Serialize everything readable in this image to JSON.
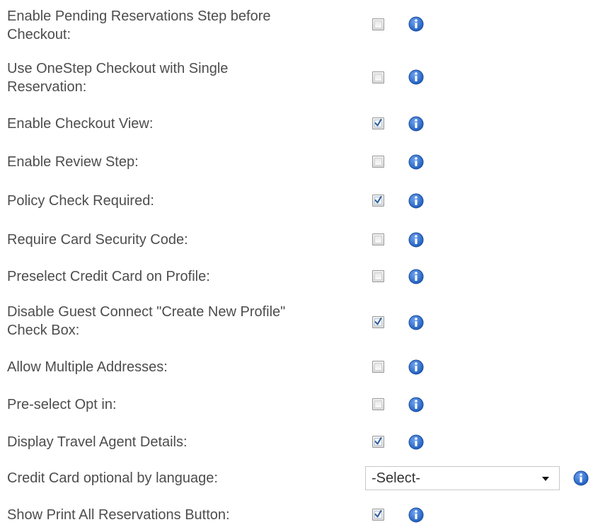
{
  "settings": {
    "rows": [
      {
        "label": "Enable Pending Reservations Step before\nCheckout:",
        "checked": false
      },
      {
        "label": "Use OneStep Checkout with Single\nReservation:",
        "checked": false
      },
      {
        "label": "Enable Checkout View:",
        "checked": true
      },
      {
        "label": "Enable Review Step:",
        "checked": false
      },
      {
        "label": "Policy Check Required:",
        "checked": true
      },
      {
        "label": "Require Card Security Code:",
        "checked": false
      },
      {
        "label": "Preselect Credit Card on Profile:",
        "checked": false
      },
      {
        "label": "Disable Guest Connect \"Create New Profile\"\nCheck Box:",
        "checked": true
      },
      {
        "label": "Allow Multiple Addresses:",
        "checked": false
      },
      {
        "label": "Pre-select Opt in:",
        "checked": false
      },
      {
        "label": "Display Travel Agent Details:",
        "checked": true
      },
      {
        "label": "Credit Card optional by language:",
        "select_value": "-Select-"
      },
      {
        "label": "Show Print All Reservations Button:",
        "checked": true
      }
    ]
  },
  "icons": {
    "info": "info-icon",
    "dropdown": "chevron-down-icon",
    "check": "check-icon"
  },
  "colors": {
    "info_blue": "#1f5fbf",
    "check_blue": "#2a5a9a",
    "label_text": "#4d4d4d"
  }
}
